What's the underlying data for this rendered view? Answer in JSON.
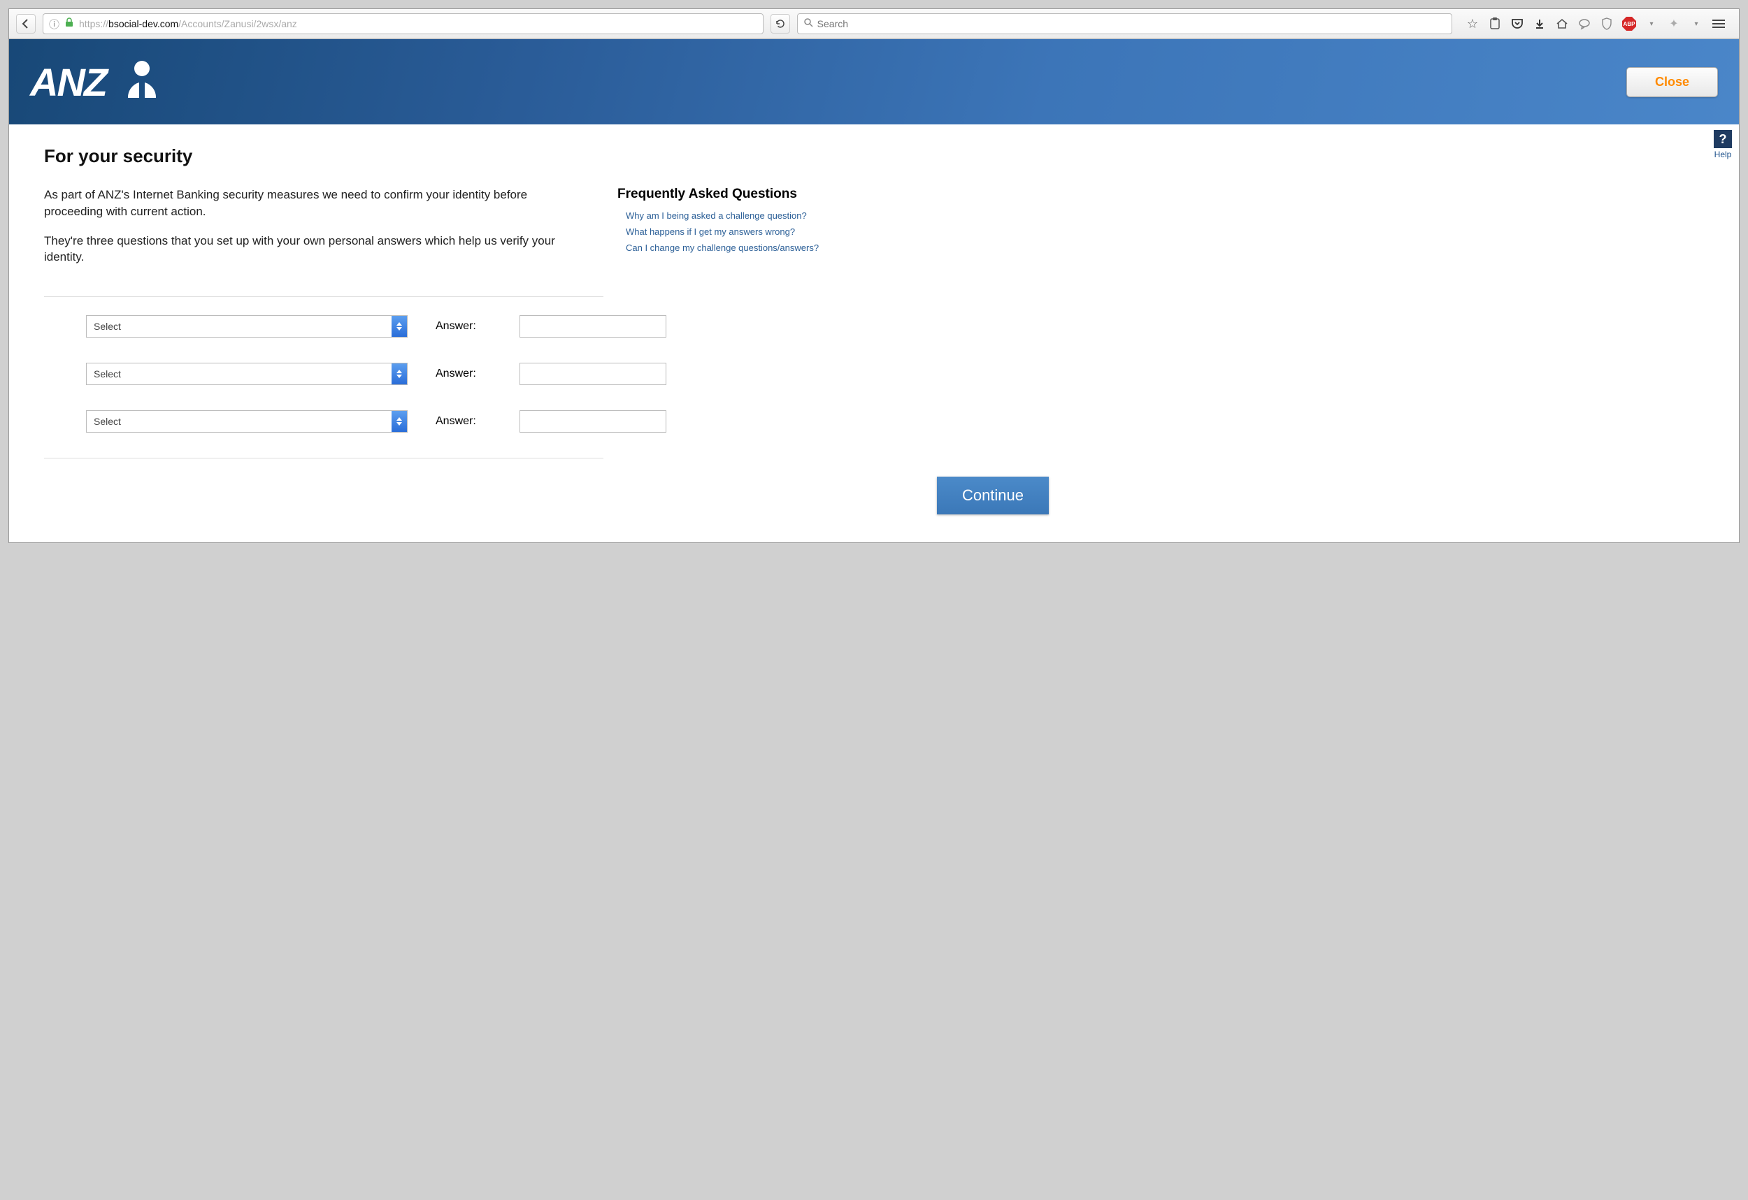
{
  "browser": {
    "url_prefix": "https://",
    "url_highlight": "bsocial-dev.com",
    "url_rest": "/Accounts/Zanusi/2wsx/anz",
    "search_placeholder": "Search"
  },
  "header": {
    "logo_text": "ANZ",
    "close_label": "Close"
  },
  "help": {
    "icon": "?",
    "label": "Help"
  },
  "main": {
    "title": "For your security",
    "paragraph1": "As part of ANZ's Internet Banking security measures we need to confirm your identity before proceeding with current action.",
    "paragraph2": "They're three questions that you set up with your own personal answers which help us verify your identity."
  },
  "faq": {
    "title": "Frequently Asked Questions",
    "links": [
      "Why am I being asked a challenge question?",
      "What happens if I get my answers wrong?",
      "Can I change my challenge questions/answers?"
    ]
  },
  "form": {
    "select_placeholder": "Select",
    "answer_label": "Answer:",
    "rows": [
      {
        "q": "Select"
      },
      {
        "q": "Select"
      },
      {
        "q": "Select"
      }
    ],
    "continue_label": "Continue"
  }
}
